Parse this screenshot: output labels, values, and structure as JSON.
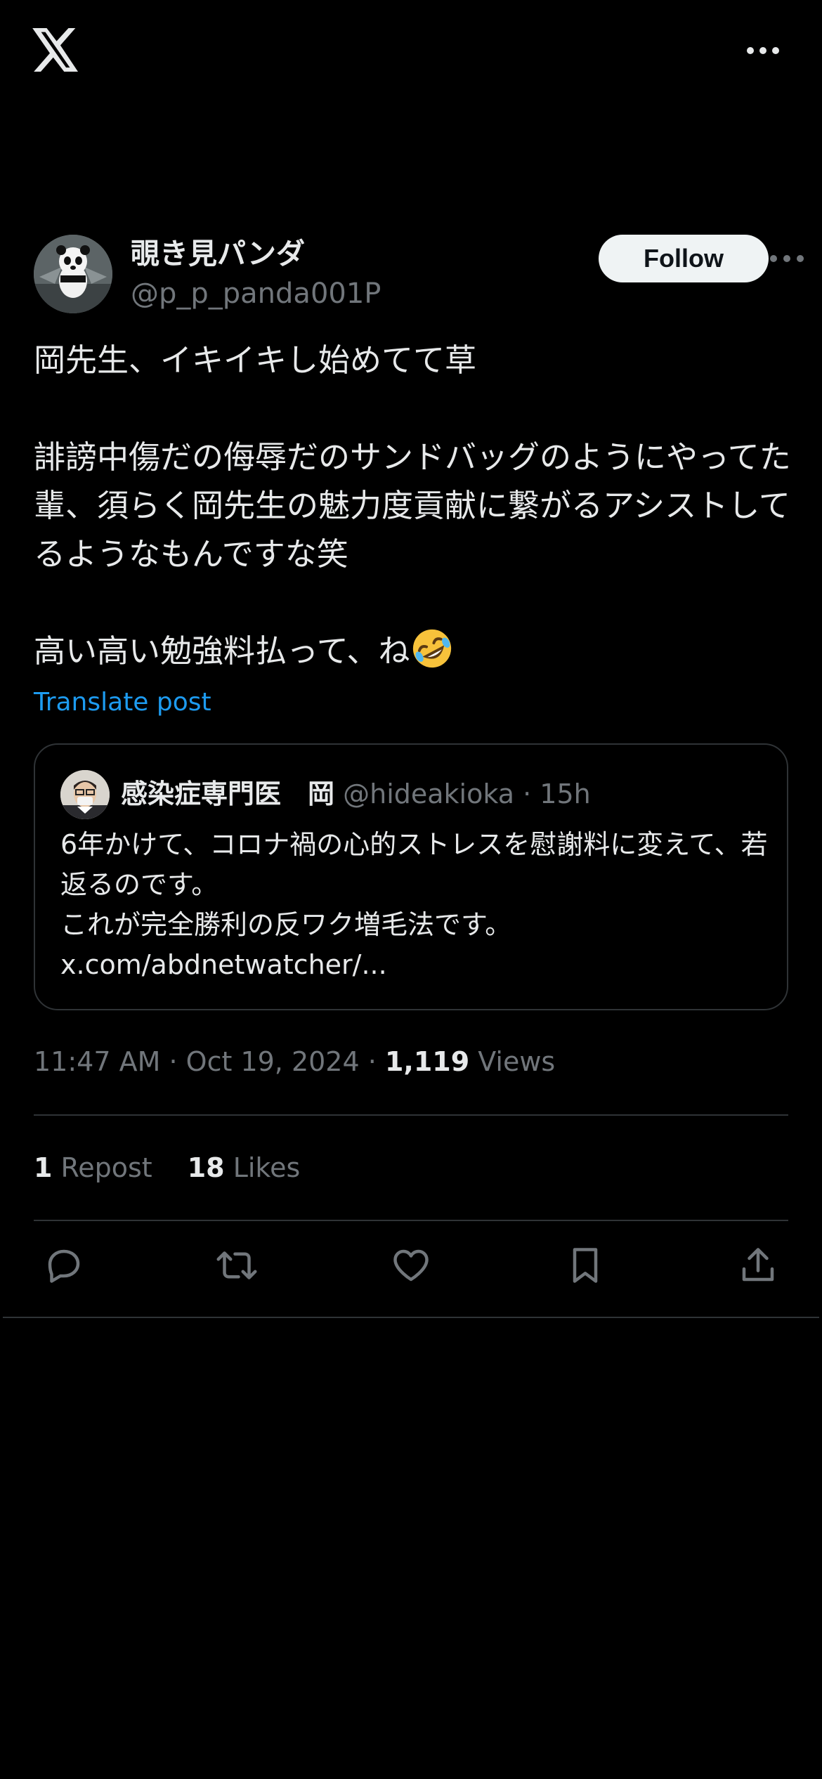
{
  "topbar": {
    "logo_icon": "x-logo-icon",
    "more_icon": "more-horizontal-icon"
  },
  "author": {
    "display_name": "覗き見パンダ",
    "handle": "@p_p_panda001P",
    "follow_label": "Follow"
  },
  "tweet": {
    "paragraphs": [
      "岡先生、イキイキし始めてて草",
      "誹謗中傷だの侮辱だのサンドバッグのようにやってた輩、須らく岡先生の魅力度貢献に繋がるアシストしてるようなもんですな笑",
      "高い高い勉強料払って、ね"
    ],
    "emoji": "rolling-on-floor-laughing-emoji",
    "translate_label": "Translate post"
  },
  "quote": {
    "name": "感染症専門医　岡",
    "handle": "@hideakioka",
    "separator": "·",
    "time": "15h",
    "lines": [
      "6年かけて、コロナ禍の心的ストレスを慰謝料に変えて、若返るのです。",
      "これが完全勝利の反ワク増毛法です。",
      "x.com/abdnetwatcher/..."
    ]
  },
  "meta": {
    "time": "11:47 AM",
    "sep1": "·",
    "date": "Oct 19, 2024",
    "sep2": "·",
    "views_count": "1,119",
    "views_label": "Views"
  },
  "stats": {
    "reposts_count": "1",
    "reposts_label": "Repost",
    "likes_count": "18",
    "likes_label": "Likes"
  },
  "actions": [
    "reply-icon",
    "repost-icon",
    "like-icon",
    "bookmark-icon",
    "share-icon"
  ],
  "colors": {
    "background": "#000000",
    "text_primary": "#e7e9ea",
    "text_secondary": "#71767b",
    "link": "#1d9bf0",
    "border": "#2f3336",
    "follow_bg": "#eff3f4"
  }
}
